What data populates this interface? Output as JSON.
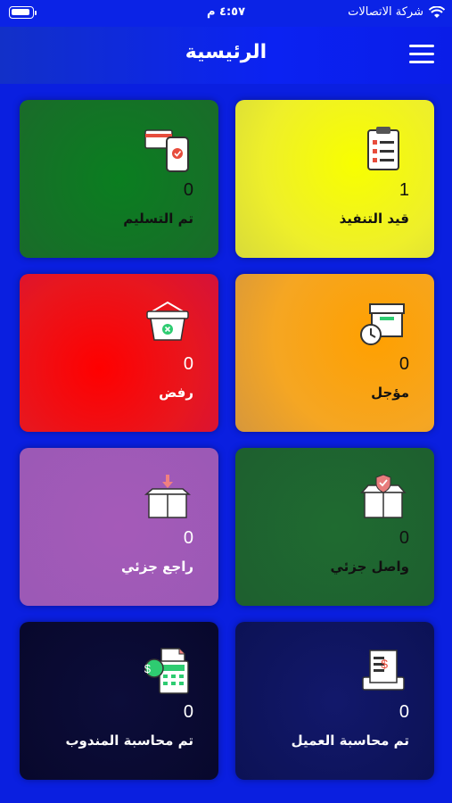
{
  "status_bar": {
    "carrier": "شركة الاتصالات",
    "time": "٤:٥٧ م"
  },
  "header": {
    "title": "الرئيسية",
    "menu_icon": "hamburger-menu-icon"
  },
  "cards": [
    {
      "label": "قيد التنفيذ",
      "count": "1",
      "icon": "clipboard-icon"
    },
    {
      "label": "تم التسليم",
      "count": "0",
      "icon": "phone-payment-icon"
    },
    {
      "label": "مؤجل",
      "count": "0",
      "icon": "box-clock-icon"
    },
    {
      "label": "رفض",
      "count": "0",
      "icon": "basket-reject-icon"
    },
    {
      "label": "واصل جزئي",
      "count": "0",
      "icon": "box-shield-icon"
    },
    {
      "label": "راجع جزئي",
      "count": "0",
      "icon": "box-return-icon"
    },
    {
      "label": "تم محاسبة العميل",
      "count": "0",
      "icon": "receipt-icon"
    },
    {
      "label": "تم محاسبة المندوب",
      "count": "0",
      "icon": "calculator-icon"
    }
  ]
}
